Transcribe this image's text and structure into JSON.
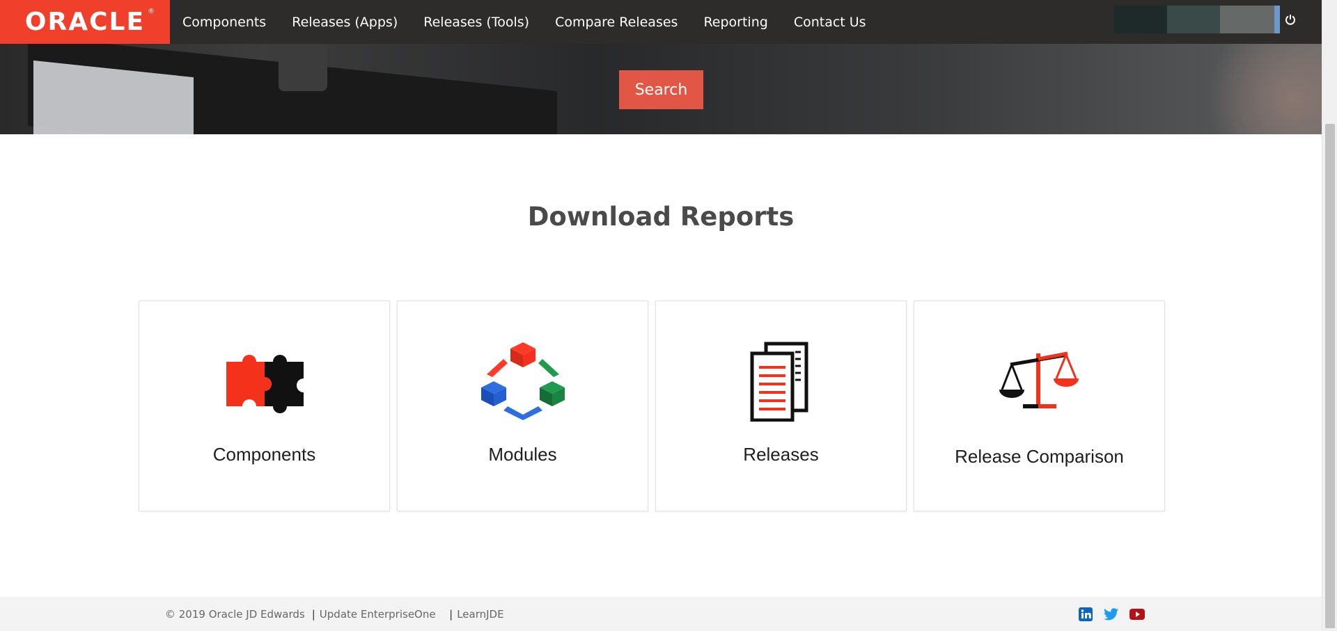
{
  "header": {
    "logo": "ORACLE",
    "nav": [
      "Components",
      "Releases (Apps)",
      "Releases (Tools)",
      "Compare Releases",
      "Reporting",
      "Contact Us"
    ]
  },
  "hero": {
    "search_label": "Search"
  },
  "main": {
    "title": "Download Reports",
    "cards": [
      "Components",
      "Modules",
      "Releases",
      "Release Comparison"
    ]
  },
  "footer": {
    "copyright": "© 2019 Oracle JD Edwards",
    "link1": "Update EnterpriseOne",
    "link2": "LearnJDE",
    "social": [
      "linkedin-icon",
      "twitter-icon",
      "youtube-icon"
    ]
  },
  "colors": {
    "brand_red": "#f03f2b",
    "button": "#e25646",
    "nav_bg": "#2d2c2a"
  }
}
